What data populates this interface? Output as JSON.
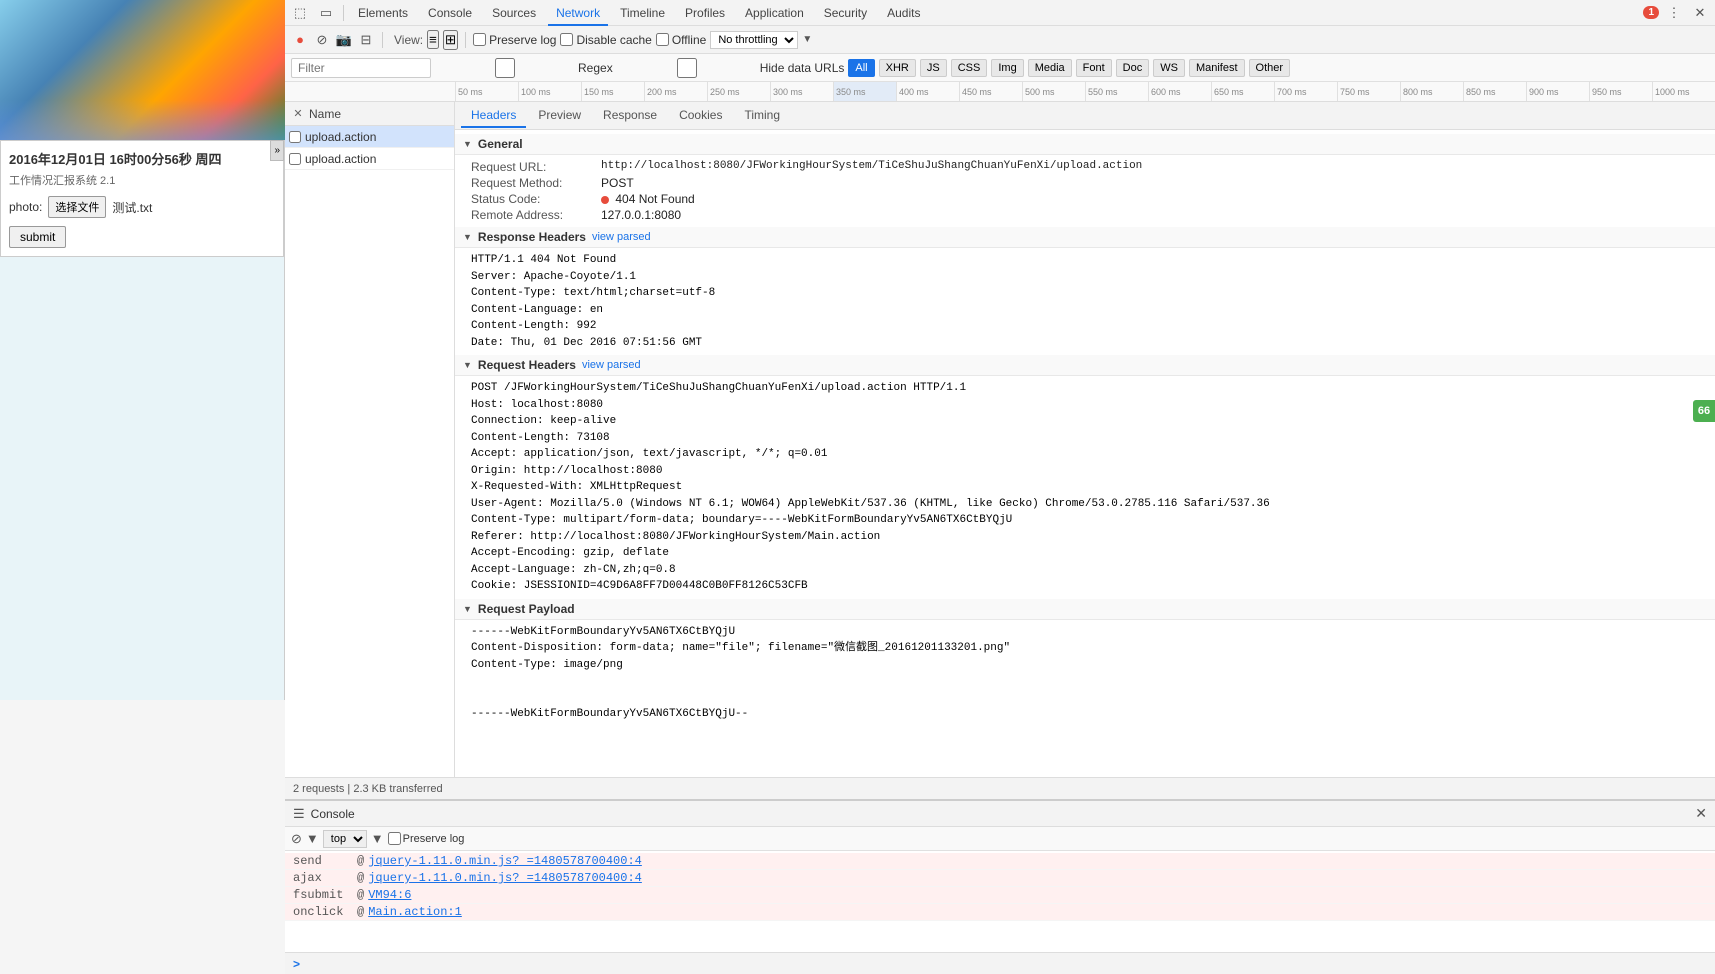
{
  "left_panel": {
    "datetime": "2016年12月01日 16时00分56秒 周四",
    "subtitle": "工作情况汇报系统 2.1",
    "photo_label": "photo:",
    "file_btn": "选择文件",
    "file_name": "测试.txt",
    "submit_btn": "submit"
  },
  "devtools": {
    "tabs": [
      {
        "label": "Elements",
        "active": false
      },
      {
        "label": "Console",
        "active": false
      },
      {
        "label": "Sources",
        "active": false
      },
      {
        "label": "Network",
        "active": true
      },
      {
        "label": "Timeline",
        "active": false
      },
      {
        "label": "Profiles",
        "active": false
      },
      {
        "label": "Application",
        "active": false
      },
      {
        "label": "Security",
        "active": false
      },
      {
        "label": "Audits",
        "active": false
      }
    ],
    "error_count": "1",
    "network_toolbar": {
      "view_label": "View:",
      "preserve_log_label": "Preserve log",
      "disable_cache_label": "Disable cache",
      "offline_label": "Offline",
      "throttle_label": "No throttling"
    },
    "filter_bar": {
      "placeholder": "Filter",
      "regex_label": "Regex",
      "hide_data_label": "Hide data URLs",
      "all_btn": "All",
      "type_btns": [
        "XHR",
        "JS",
        "CSS",
        "Img",
        "Media",
        "Font",
        "Doc",
        "WS",
        "Manifest",
        "Other"
      ]
    },
    "timeline_marks": [
      "50 ms",
      "100 ms",
      "150 ms",
      "200 ms",
      "250 ms",
      "300 ms",
      "350 ms",
      "400 ms",
      "450 ms",
      "500 ms",
      "550 ms",
      "600 ms",
      "650 ms",
      "700 ms",
      "750 ms",
      "800 ms",
      "850 ms",
      "900 ms",
      "950 ms",
      "1000 ms"
    ],
    "requests": [
      {
        "name": "upload.action",
        "selected": true
      },
      {
        "name": "upload.action",
        "selected": false
      }
    ],
    "detail_tabs": [
      {
        "label": "Headers",
        "active": true
      },
      {
        "label": "Preview",
        "active": false
      },
      {
        "label": "Response",
        "active": false
      },
      {
        "label": "Cookies",
        "active": false
      },
      {
        "label": "Timing",
        "active": false
      }
    ],
    "general": {
      "title": "General",
      "request_url_label": "Request URL:",
      "request_url_val": "http://localhost:8080/JFWorkingHourSystem/TiCeShuJuShangChuanYuFenXi/upload.action",
      "method_label": "Request Method:",
      "method_val": "POST",
      "status_label": "Status Code:",
      "status_val": "404 Not Found",
      "remote_label": "Remote Address:",
      "remote_val": "127.0.0.1:8080"
    },
    "response_headers": {
      "title": "Response Headers",
      "view_parsed": "view parsed",
      "lines": [
        "HTTP/1.1 404 Not Found",
        "Server: Apache-Coyote/1.1",
        "Content-Type: text/html;charset=utf-8",
        "Content-Language: en",
        "Content-Length: 992",
        "Date: Thu, 01 Dec 2016 07:51:56 GMT"
      ]
    },
    "request_headers": {
      "title": "Request Headers",
      "view_parsed": "view parsed",
      "lines": [
        "POST /JFWorkingHourSystem/TiCeShuJuShangChuanYuFenXi/upload.action HTTP/1.1",
        "Host: localhost:8080",
        "Connection: keep-alive",
        "Content-Length: 73108",
        "Accept: application/json, text/javascript, */*; q=0.01",
        "Origin: http://localhost:8080",
        "X-Requested-With: XMLHttpRequest",
        "User-Agent: Mozilla/5.0 (Windows NT 6.1; WOW64) AppleWebKit/537.36 (KHTML, like Gecko) Chrome/53.0.2785.116 Safari/537.36",
        "Content-Type: multipart/form-data; boundary=----WebKitFormBoundaryYv5AN6TX6CtBYQjU",
        "Referer: http://localhost:8080/JFWorkingHourSystem/Main.action",
        "Accept-Encoding: gzip, deflate",
        "Accept-Language: zh-CN,zh;q=0.8",
        "Cookie: JSESSIONID=4C9D6A8FF7D00448C0B0FF8126C53CFB"
      ]
    },
    "request_payload": {
      "title": "Request Payload",
      "lines": [
        "------WebKitFormBoundaryYv5AN6TX6CtBYQjU",
        "Content-Disposition: form-data; name=\"file\"; filename=\"微信截图_20161201133201.png\"",
        "Content-Type: image/png",
        "",
        "",
        "------WebKitFormBoundaryYv5AN6TX6CtBYQjU--"
      ]
    },
    "status_bar": {
      "text": "2 requests | 2.3 KB transferred"
    }
  },
  "console": {
    "tab_label": "Console",
    "toolbar": {
      "top_label": "top",
      "preserve_log_label": "Preserve log"
    },
    "rows": [
      {
        "label": "send",
        "at": "@",
        "link": "jquery-1.11.0.min.js? =1480578700400:4"
      },
      {
        "label": "ajax",
        "at": "@",
        "link": "jquery-1.11.0.min.js? =1480578700400:4"
      },
      {
        "label": "fsubmit",
        "at": "@",
        "link": "VM94:6"
      },
      {
        "label": "onclick",
        "at": "@",
        "link": "Main.action:1"
      }
    ],
    "prompt_symbol": ">"
  },
  "right_badge": "66"
}
